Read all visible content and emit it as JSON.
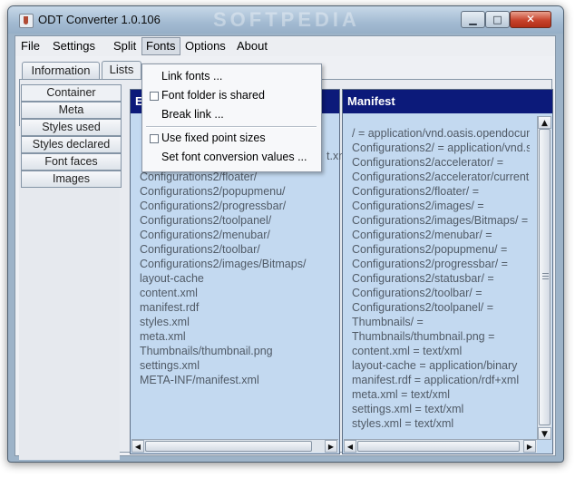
{
  "window": {
    "title": "ODT Converter 1.0.106",
    "watermark": "SOFTPEDIA",
    "minimize_glyph": "▁",
    "maximize_glyph": "□",
    "close_glyph": "✕"
  },
  "menubar": {
    "items": [
      {
        "label": "File"
      },
      {
        "label": "Settings"
      },
      {
        "label": "Split"
      },
      {
        "label": "Fonts"
      },
      {
        "label": "Options"
      },
      {
        "label": "About"
      }
    ],
    "open_menu": "Fonts"
  },
  "fonts_menu": {
    "items": [
      {
        "label": "Link fonts ...",
        "checkbox": false
      },
      {
        "label": "Font folder is shared",
        "checkbox": true
      },
      {
        "label": "Break link ...",
        "checkbox": false
      },
      {
        "label": "Use fixed point sizes",
        "checkbox": true
      },
      {
        "label": "Set font conversion values ...",
        "checkbox": false
      }
    ]
  },
  "tabs": {
    "items": [
      {
        "label": "Information"
      },
      {
        "label": "Lists"
      }
    ],
    "active": "Lists"
  },
  "side_tabs": {
    "items": [
      {
        "label": "Container"
      },
      {
        "label": "Meta"
      },
      {
        "label": "Styles used"
      },
      {
        "label": "Styles declared"
      },
      {
        "label": "Font faces"
      },
      {
        "label": "Images"
      }
    ],
    "active": "Container"
  },
  "left_panel": {
    "header": "E",
    "partial_fragment": "t.xm",
    "files": [
      "Configurations2/floater/",
      "Configurations2/popupmenu/",
      "Configurations2/progressbar/",
      "Configurations2/toolpanel/",
      "Configurations2/menubar/",
      "Configurations2/toolbar/",
      "Configurations2/images/Bitmaps/",
      "layout-cache",
      "content.xml",
      "manifest.rdf",
      "styles.xml",
      "meta.xml",
      "Thumbnails/thumbnail.png",
      "settings.xml",
      "META-INF/manifest.xml"
    ]
  },
  "right_panel": {
    "header": "Manifest",
    "entries": [
      "/ = application/vnd.oasis.opendocum",
      "Configurations2/ = application/vnd.su",
      "Configurations2/accelerator/ =",
      "Configurations2/accelerator/current",
      "Configurations2/floater/ =",
      "Configurations2/images/ =",
      "Configurations2/images/Bitmaps/ =",
      "Configurations2/menubar/ =",
      "Configurations2/popupmenu/ =",
      "Configurations2/progressbar/ =",
      "Configurations2/statusbar/ =",
      "Configurations2/toolbar/ =",
      "Configurations2/toolpanel/ =",
      "Thumbnails/ =",
      "Thumbnails/thumbnail.png =",
      "content.xml = text/xml",
      "layout-cache = application/binary",
      "manifest.rdf = application/rdf+xml",
      "meta.xml = text/xml",
      "settings.xml = text/xml",
      "styles.xml = text/xml"
    ]
  },
  "scroll_glyphs": {
    "up": "▲",
    "down": "▼",
    "left": "◀",
    "right": "▶"
  },
  "colors": {
    "panel_header": "#0c1a7a",
    "panel_bg": "#c3d9f0",
    "window_frame": "#9db3c8"
  }
}
